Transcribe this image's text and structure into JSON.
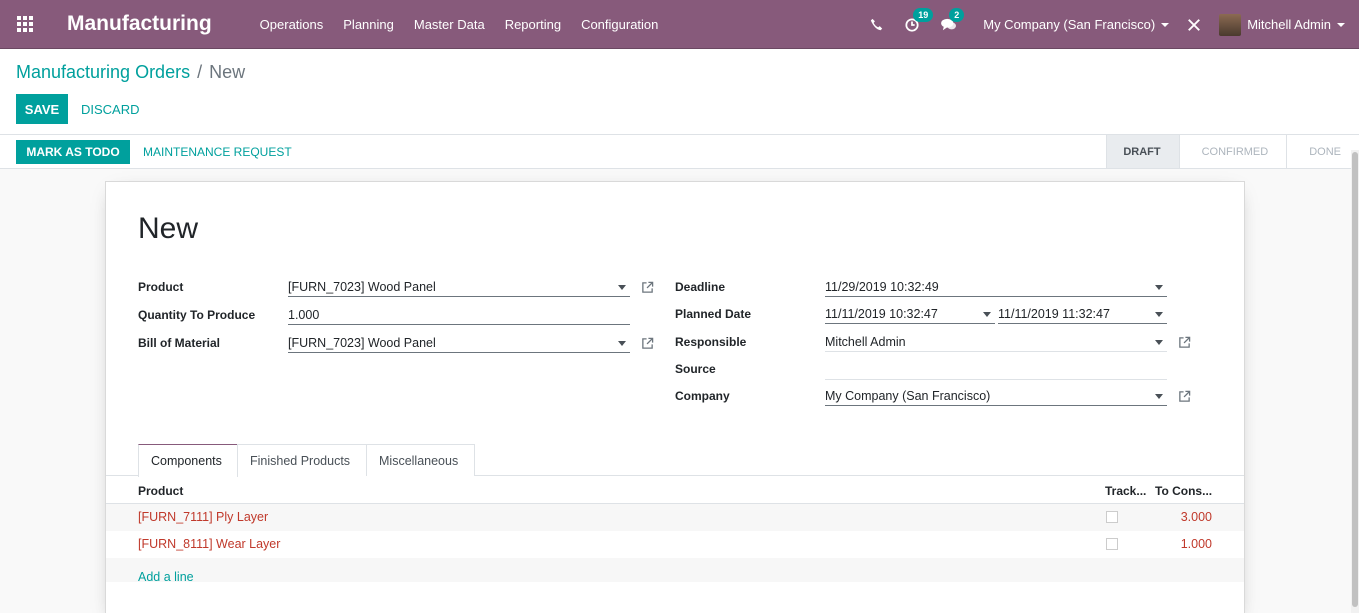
{
  "navbar": {
    "brand": "Manufacturing",
    "menu": [
      "Operations",
      "Planning",
      "Master Data",
      "Reporting",
      "Configuration"
    ],
    "activity_count": "19",
    "message_count": "2",
    "company": "My Company (San Francisco)",
    "user": "Mitchell Admin"
  },
  "breadcrumb": {
    "parent": "Manufacturing Orders",
    "separator": "/",
    "current": "New"
  },
  "buttons": {
    "save": "SAVE",
    "discard": "DISCARD",
    "mark_todo": "MARK AS TODO",
    "maintenance": "MAINTENANCE REQUEST"
  },
  "stages": [
    "DRAFT",
    "CONFIRMED",
    "DONE"
  ],
  "form": {
    "title": "New",
    "product_label": "Product",
    "product_value": "[FURN_7023] Wood Panel",
    "qty_label": "Quantity To Produce",
    "qty_value": "1.000",
    "bom_label": "Bill of Material",
    "bom_value": "[FURN_7023] Wood Panel",
    "deadline_label": "Deadline",
    "deadline_value": "11/29/2019 10:32:49",
    "planned_label": "Planned Date",
    "planned_start": "11/11/2019 10:32:47",
    "planned_end": "11/11/2019 11:32:47",
    "responsible_label": "Responsible",
    "responsible_value": "Mitchell Admin",
    "source_label": "Source",
    "source_value": "",
    "company_label": "Company",
    "company_value": "My Company (San Francisco)"
  },
  "tabs": [
    "Components",
    "Finished Products",
    "Miscellaneous"
  ],
  "table": {
    "headers": {
      "product": "Product",
      "track": "Track...",
      "to_consume": "To Cons..."
    },
    "rows": [
      {
        "product": "[FURN_7111] Ply Layer",
        "qty": "3.000"
      },
      {
        "product": "[FURN_8111] Wear Layer",
        "qty": "1.000"
      }
    ],
    "add_line": "Add a line"
  }
}
